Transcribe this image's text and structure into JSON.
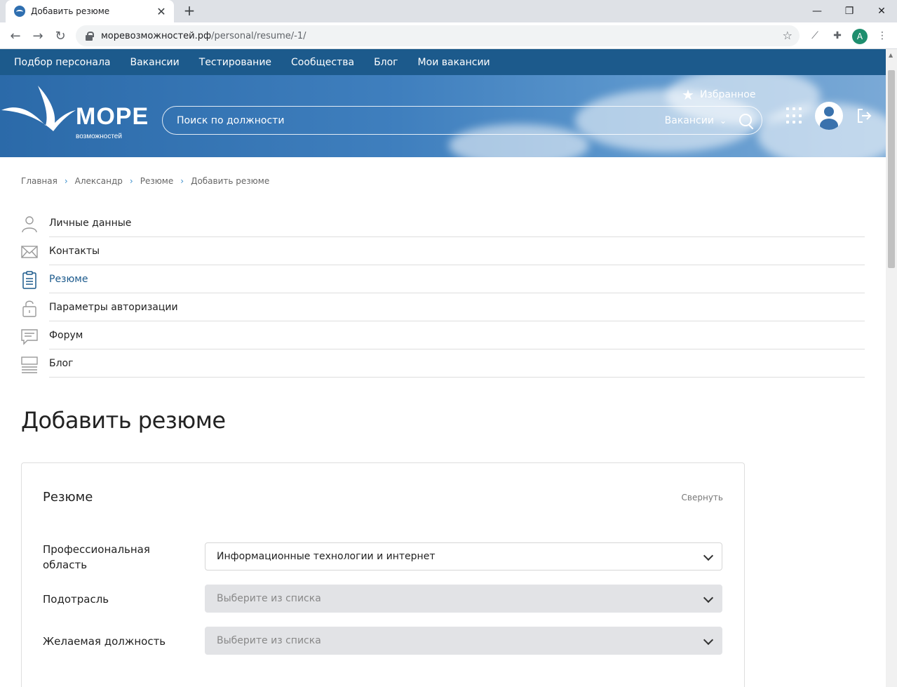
{
  "browser": {
    "tab_title": "Добавить резюме",
    "url_host": "моревозможностей.рф",
    "url_path": "/personal/resume/-1/",
    "profile_initial": "A"
  },
  "site": {
    "topnav": [
      "Подбор персонала",
      "Вакансии",
      "Тестирование",
      "Сообщества",
      "Блог",
      "Мои вакансии"
    ],
    "logo_word": "МОРЕ",
    "logo_sub": "возможностей",
    "favorites_label": "Избранное",
    "search_placeholder": "Поиск по должности",
    "search_scope": "Вакансии"
  },
  "breadcrumb": [
    "Главная",
    "Александр",
    "Резюме",
    "Добавить резюме"
  ],
  "menu": [
    {
      "label": "Личные данные",
      "icon": "person-icon"
    },
    {
      "label": "Контакты",
      "icon": "envelope-icon"
    },
    {
      "label": "Резюме",
      "icon": "clipboard-icon",
      "active": true
    },
    {
      "label": "Параметры авторизации",
      "icon": "lock-icon"
    },
    {
      "label": "Форум",
      "icon": "chat-icon"
    },
    {
      "label": "Блог",
      "icon": "blog-icon"
    }
  ],
  "page_title": "Добавить резюме",
  "card": {
    "title": "Резюме",
    "collapse_label": "Свернуть",
    "fields": [
      {
        "label": "Профессиональная область",
        "value": "Информационные технологии и интернет"
      },
      {
        "label": "Подотрасль",
        "value": "Выберите из списка"
      },
      {
        "label": "Желаемая должность",
        "value": "Выберите из списка"
      }
    ]
  },
  "colors": {
    "brand": "#1c5a8c",
    "active_menu": "#1c5a8c",
    "link_arrow": "#3a8fcc"
  }
}
